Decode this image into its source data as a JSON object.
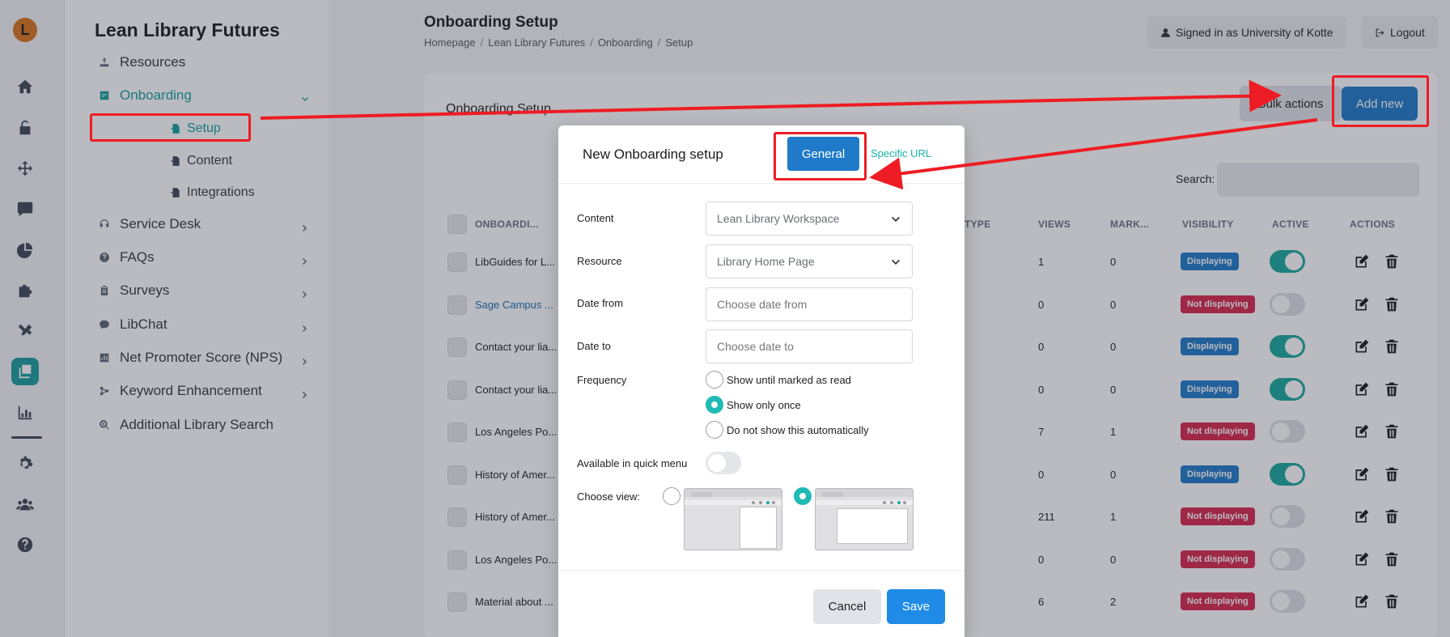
{
  "app": {
    "logo_letter": "L"
  },
  "nav": {
    "title": "Lean Library Futures",
    "items": [
      {
        "label": "Resources",
        "icon": "resources-icon"
      },
      {
        "label": "Onboarding",
        "icon": "onboarding-icon"
      },
      {
        "label": "Service Desk",
        "icon": "headset-icon"
      },
      {
        "label": "FAQs",
        "icon": "question-icon"
      },
      {
        "label": "Surveys",
        "icon": "clipboard-icon"
      },
      {
        "label": "LibChat",
        "icon": "chat-icon"
      },
      {
        "label": "Net Promoter Score (NPS)",
        "icon": "chart-icon"
      },
      {
        "label": "Keyword Enhancement",
        "icon": "network-icon"
      },
      {
        "label": "Additional Library Search",
        "icon": "zoom-icon"
      }
    ],
    "onboarding_sub": [
      "Setup",
      "Content",
      "Integrations"
    ]
  },
  "header": {
    "title": "Onboarding Setup",
    "breadcrumb": [
      "Homepage",
      "Lean Library Futures",
      "Onboarding",
      "Setup"
    ],
    "signed_in": "Signed in as University of Kotte",
    "logout": "Logout"
  },
  "card": {
    "title": "Onboarding Setup",
    "bulk_actions": "Bulk actions",
    "add_new": "Add new",
    "search_label": "Search:"
  },
  "table": {
    "columns": {
      "name": "ONBOARDI...",
      "type": "TYPE",
      "views": "VIEWS",
      "mark": "MARK...",
      "visibility": "VISIBILITY",
      "active": "ACTIVE",
      "actions": "ACTIONS"
    },
    "rows": [
      {
        "name": "LibGuides for L...",
        "views": "1",
        "mark": "0",
        "visibility": "Displaying",
        "active": true,
        "link": false
      },
      {
        "name": "Sage Campus ...",
        "views": "0",
        "mark": "0",
        "visibility": "Not displaying",
        "active": false,
        "link": true
      },
      {
        "name": "Contact your lia...",
        "views": "0",
        "mark": "0",
        "visibility": "Displaying",
        "active": true,
        "link": false
      },
      {
        "name": "Contact your lia...",
        "views": "0",
        "mark": "0",
        "visibility": "Displaying",
        "active": true,
        "link": false
      },
      {
        "name": "Los Angeles Po...",
        "views": "7",
        "mark": "1",
        "visibility": "Not displaying",
        "active": false,
        "link": false
      },
      {
        "name": "History of Amer...",
        "views": "0",
        "mark": "0",
        "visibility": "Displaying",
        "active": true,
        "link": false
      },
      {
        "name": "History of Amer...",
        "views": "211",
        "mark": "1",
        "visibility": "Not displaying",
        "active": false,
        "link": false
      },
      {
        "name": "Los Angeles Po...",
        "views": "0",
        "mark": "0",
        "visibility": "Not displaying",
        "active": false,
        "link": false
      },
      {
        "name": "Material about ...",
        "views": "6",
        "mark": "2",
        "visibility": "Not displaying",
        "active": false,
        "link": false
      }
    ]
  },
  "modal": {
    "title": "New Onboarding setup",
    "tab_general": "General",
    "tab_specific_url": "Specific URL",
    "content_label": "Content",
    "content_value": "Lean Library Workspace",
    "resource_label": "Resource",
    "resource_value": "Library Home Page",
    "date_from_label": "Date from",
    "date_from_placeholder": "Choose date from",
    "date_to_label": "Date to",
    "date_to_placeholder": "Choose date to",
    "frequency_label": "Frequency",
    "frequency_options": [
      "Show until marked as read",
      "Show only once",
      "Do not show this automatically"
    ],
    "frequency_selected": "Show only once",
    "quick_menu_label": "Available in quick menu",
    "quick_menu_on": false,
    "choose_view_label": "Choose view:",
    "cancel": "Cancel",
    "save": "Save"
  },
  "colors": {
    "accent_teal": "#16a09c",
    "primary_blue": "#1f7ac9",
    "annotation_red": "#ee1c24",
    "badge_on": "#1f7ac9",
    "badge_off": "#d7274d"
  }
}
